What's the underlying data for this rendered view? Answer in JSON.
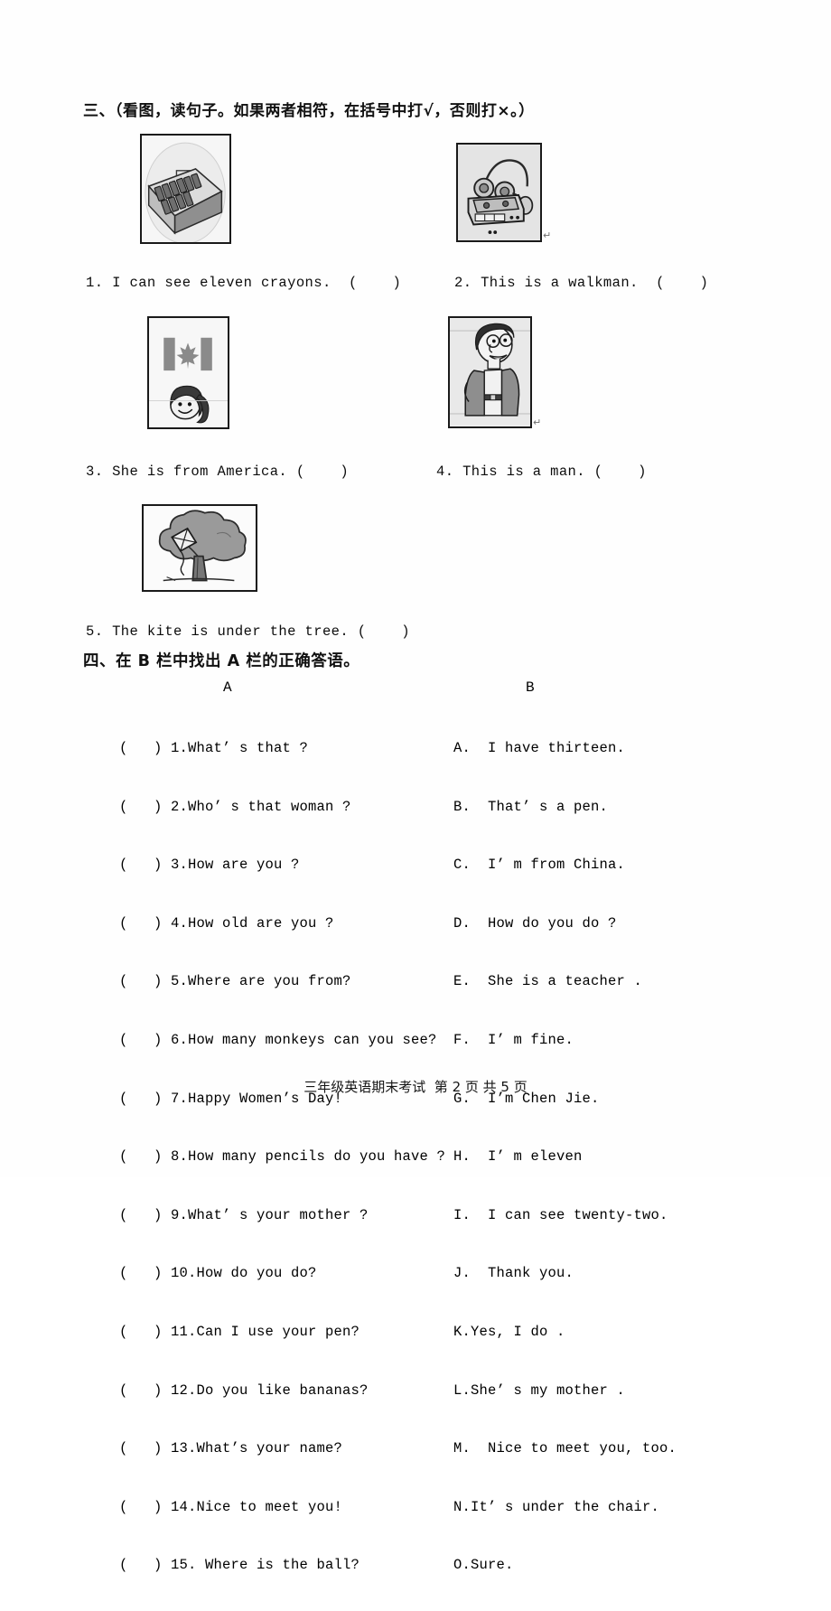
{
  "section3": {
    "heading": "三、（看图，读句子。如果两者相符，在括号中打√，否则打×。）",
    "items": [
      {
        "num": "1.",
        "text": "I can see eleven crayons.",
        "answer_box": "(      )",
        "picture": "crayon-box-picture"
      },
      {
        "num": "2.",
        "text": "This is a walkman.",
        "answer_box": "(      )",
        "picture": "walkman-picture"
      },
      {
        "num": "3.",
        "text": "She is from America.",
        "answer_box": "(      )",
        "picture": "canada-flag-girl-picture"
      },
      {
        "num": "4.",
        "text": "This is a man.",
        "answer_box": "(      )",
        "picture": "man-picture"
      },
      {
        "num": "5.",
        "text": "The kite is under the tree.",
        "answer_box": "(      )",
        "picture": "kite-in-tree-picture"
      }
    ],
    "line1_full": "1. I can see eleven crayons.  (    )",
    "line2_full": "2. This is a walkman.  (    )",
    "line3_full": "3. She is from America. (    )",
    "line4_full": "4. This is a man. (    )",
    "line5_full": "5. The kite is under the tree. (    )",
    "enter_mark": "↵"
  },
  "section4": {
    "heading": "四、在 B 栏中找出 A 栏的正确答语。",
    "columnA_header": "A",
    "columnB_header": "B",
    "columnA": [
      "(   ) 1.What’ s that ?",
      "(   ) 2.Who’ s that woman ?",
      "(   ) 3.How are you ?",
      "(   ) 4.How old are you ?",
      "(   ) 5.Where are you from?",
      "(   ) 6.How many monkeys can you see?",
      "(   ) 7.Happy Women’s Day!",
      "(   ) 8.How many pencils do you have ?",
      "(   ) 9.What’ s your mother ?",
      "(   ) 10.How do you do?",
      "(   ) 11.Can I use your pen?",
      "(   ) 12.Do you like bananas?",
      "(   ) 13.What’s your name?",
      "(   ) 14.Nice to meet you!",
      "(   ) 15. Where is the ball?"
    ],
    "columnB": [
      "A.  I have thirteen.",
      "B.  That’ s a pen.",
      "C.  I’ m from China.",
      "D.  How do you do ?",
      "E.  She is a teacher .",
      "F.  I’ m fine.",
      "G.  I’m Chen Jie.",
      "H.  I’ m eleven",
      "I.  I can see twenty-two.",
      "J.  Thank you.",
      "K.Yes, I do .",
      "L.She’ s my mother .",
      "M.  Nice to meet you, too.",
      "N.It’ s under the chair.",
      "O.Sure."
    ]
  },
  "footer": {
    "text": "三年级英语期末考试  第 2 页 共 5 页"
  }
}
